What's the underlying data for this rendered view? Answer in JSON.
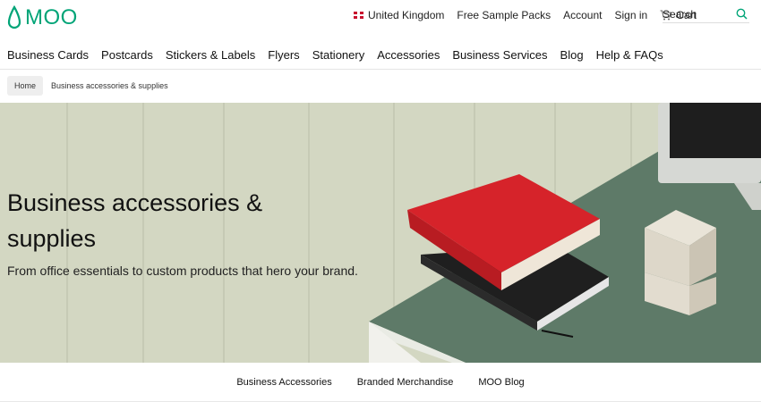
{
  "brand": {
    "logo_text": "MOO",
    "accent": "#00a477"
  },
  "utility": {
    "country": "United Kingdom",
    "samples": "Free Sample Packs",
    "account": "Account",
    "signin": "Sign in",
    "cart": "Cart",
    "search_placeholder": "Search"
  },
  "nav": [
    "Business Cards",
    "Postcards",
    "Stickers & Labels",
    "Flyers",
    "Stationery",
    "Accessories",
    "Business Services",
    "Blog",
    "Help & FAQs"
  ],
  "breadcrumb": {
    "home": "Home",
    "current": "Business accessories & supplies"
  },
  "hero": {
    "title": "Business accessories & supplies",
    "subtitle": "From office essentials to custom products that hero your brand."
  },
  "subnav": [
    "Business Accessories",
    "Branded Merchandise",
    "MOO Blog"
  ]
}
